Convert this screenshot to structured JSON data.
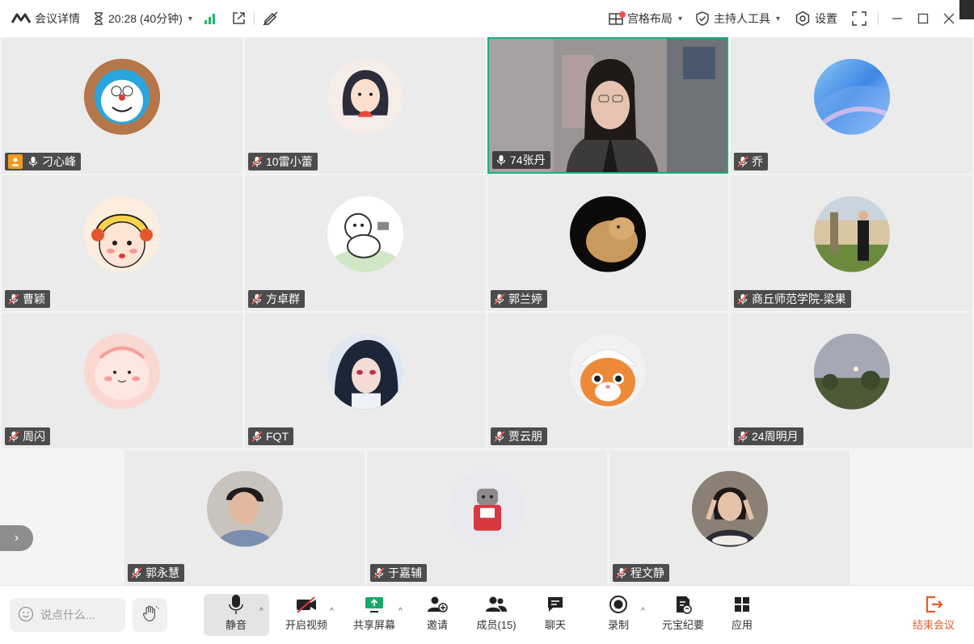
{
  "topbar": {
    "meeting_details": "会议详情",
    "timer": "20:28 (40分钟)",
    "layout_label": "宫格布局",
    "host_tools_label": "主持人工具",
    "settings_label": "设置"
  },
  "participants": [
    {
      "name": "刁心峰",
      "host": true,
      "mic": "on"
    },
    {
      "name": "10雷小蕾",
      "mic": "muted"
    },
    {
      "name": "74张丹",
      "mic": "on",
      "active": true
    },
    {
      "name": "乔",
      "mic": "muted"
    },
    {
      "name": "曹颖",
      "mic": "muted"
    },
    {
      "name": "方卓群",
      "mic": "muted"
    },
    {
      "name": "郭兰婷",
      "mic": "muted"
    },
    {
      "name": "商丘师范学院-梁果",
      "mic": "muted"
    },
    {
      "name": "周闪",
      "mic": "muted"
    },
    {
      "name": "FQT",
      "mic": "muted"
    },
    {
      "name": "贾云朋",
      "mic": "muted"
    },
    {
      "name": "24周明月",
      "mic": "muted"
    },
    {
      "name": "郭永慧",
      "mic": "muted"
    },
    {
      "name": "于嘉辅",
      "mic": "muted"
    },
    {
      "name": "程文静",
      "mic": "muted"
    }
  ],
  "toolbar": {
    "say_placeholder": "说点什么...",
    "mute_label": "静音",
    "video_label": "开启视频",
    "share_label": "共享屏幕",
    "invite_label": "邀请",
    "members_label": "成员(15)",
    "chat_label": "聊天",
    "record_label": "录制",
    "minutes_label": "元宝纪要",
    "apps_label": "应用",
    "end_label": "结束会议"
  },
  "colors": {
    "active_border": "#17b37b",
    "signal_green": "#1fb96c",
    "host_badge": "#f39a1c",
    "end_red": "#e35b29",
    "notify_dot": "#ff4d4f"
  }
}
